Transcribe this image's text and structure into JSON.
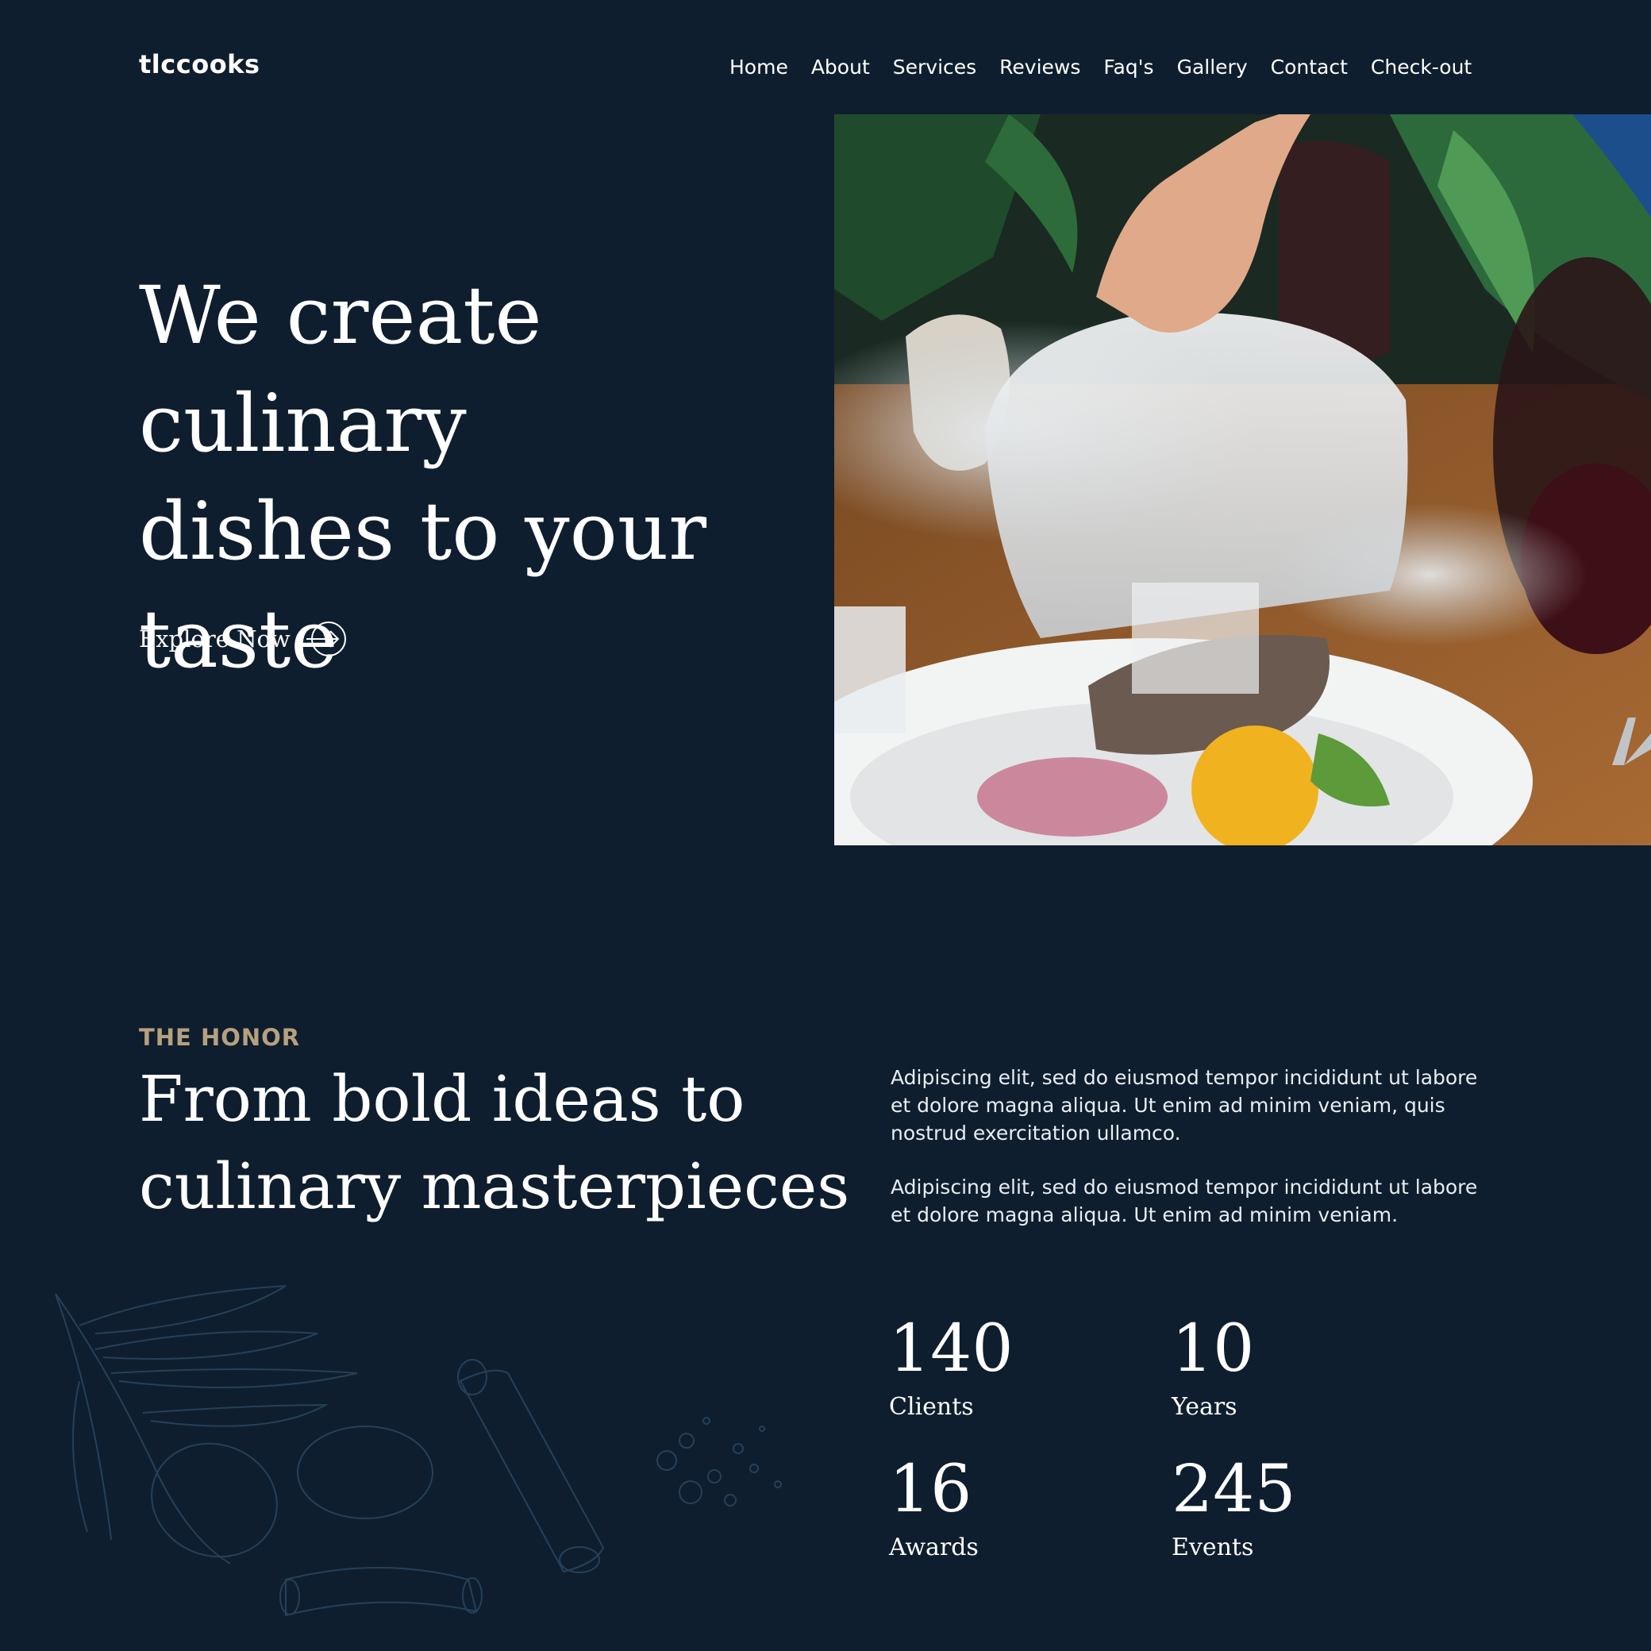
{
  "header": {
    "logo": "tlccooks",
    "nav": [
      "Home",
      "About",
      "Services",
      "Reviews",
      "Faq's",
      "Gallery",
      "Contact",
      "Check-out"
    ]
  },
  "hero": {
    "title": "We create culinary dishes to your taste",
    "cta_label": "Explore Now",
    "cta_icon": "arrow-right-circle-icon"
  },
  "honor": {
    "eyebrow": "THE HONOR",
    "title": "From bold ideas to culinary masterpieces",
    "paragraphs": [
      "Adipiscing elit, sed do eiusmod tempor incididunt ut labore et dolore magna aliqua. Ut enim ad minim veniam, quis nostrud exercitation ullamco.",
      "Adipiscing elit, sed do eiusmod tempor incididunt ut labore et dolore magna aliqua. Ut enim ad minim veniam."
    ],
    "stats": [
      {
        "value": "140",
        "label": "Clients"
      },
      {
        "value": "10",
        "label": "Years"
      },
      {
        "value": "16",
        "label": "Awards"
      },
      {
        "value": "245",
        "label": "Events"
      }
    ]
  },
  "colors": {
    "background": "#0f1e2e",
    "text": "#ffffff",
    "accent": "#b5a17f",
    "illustration_line": "#25405a"
  }
}
